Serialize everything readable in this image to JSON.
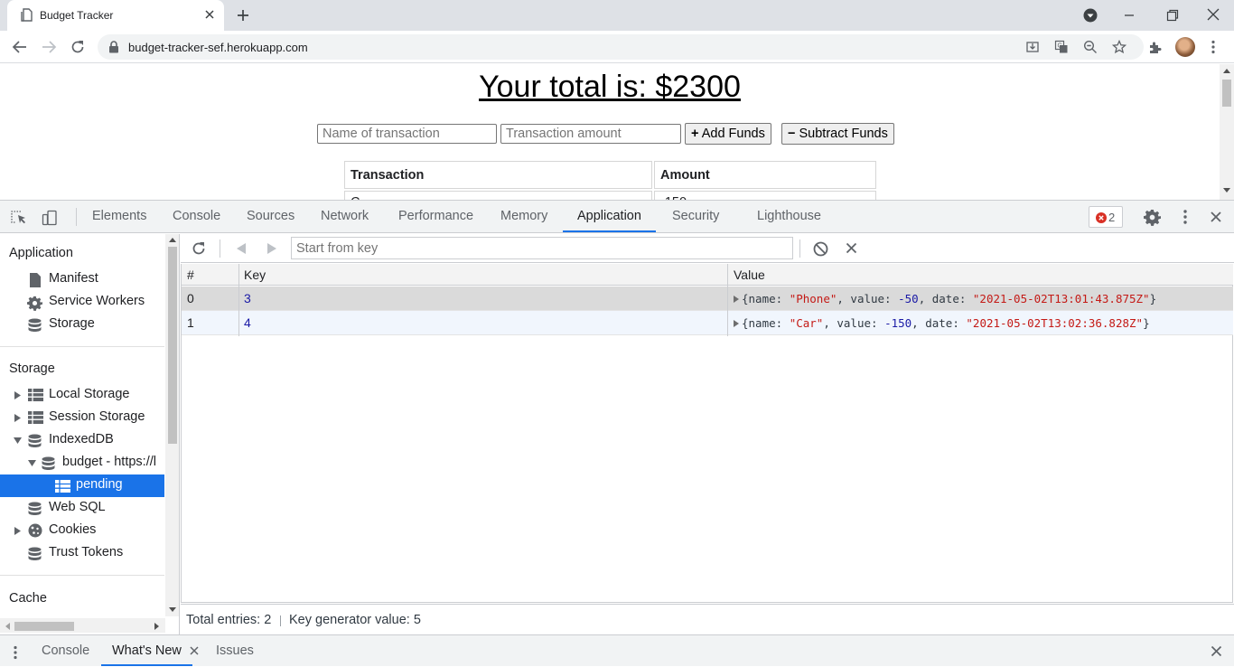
{
  "browser": {
    "tab_title": "Budget Tracker",
    "url": "budget-tracker-sef.herokuapp.com"
  },
  "page": {
    "total_text": "Your total is: $2300",
    "name_placeholder": "Name of transaction",
    "amount_placeholder": "Transaction amount",
    "add_label": "Add Funds",
    "subtract_label": "Subtract Funds",
    "table_headers": [
      "Transaction",
      "Amount"
    ],
    "partial_row": [
      "C",
      "-150"
    ]
  },
  "devtools": {
    "tabs": [
      "Elements",
      "Console",
      "Sources",
      "Network",
      "Performance",
      "Memory",
      "Application",
      "Security",
      "Lighthouse"
    ],
    "active_tab": "Application",
    "error_count": "2",
    "sidebar": {
      "application_header": "Application",
      "application_items": [
        "Manifest",
        "Service Workers",
        "Storage"
      ],
      "storage_header": "Storage",
      "storage_items": [
        "Local Storage",
        "Session Storage",
        "IndexedDB",
        "budget - https://l",
        "pending",
        "Web SQL",
        "Cookies",
        "Trust Tokens"
      ],
      "cache_header": "Cache",
      "selected": "pending"
    },
    "idb": {
      "key_placeholder": "Start from key",
      "columns": [
        "#",
        "Key",
        "Value"
      ],
      "rows": [
        {
          "index": "0",
          "key": "3",
          "name": "\"Phone\"",
          "value": "-50",
          "date": "\"2021-05-02T13:01:43.875Z\""
        },
        {
          "index": "1",
          "key": "4",
          "name": "\"Car\"",
          "value": "-150",
          "date": "\"2021-05-02T13:02:36.828Z\""
        }
      ],
      "total_entries": "Total entries: 2",
      "key_generator": "Key generator value: 5"
    },
    "drawer": {
      "tabs": [
        "Console",
        "What's New",
        "Issues"
      ],
      "active_tab": "What's New"
    }
  },
  "colors": {
    "accent": "#1a73e8",
    "string": "#c41a16",
    "number": "#1a1aa6"
  }
}
